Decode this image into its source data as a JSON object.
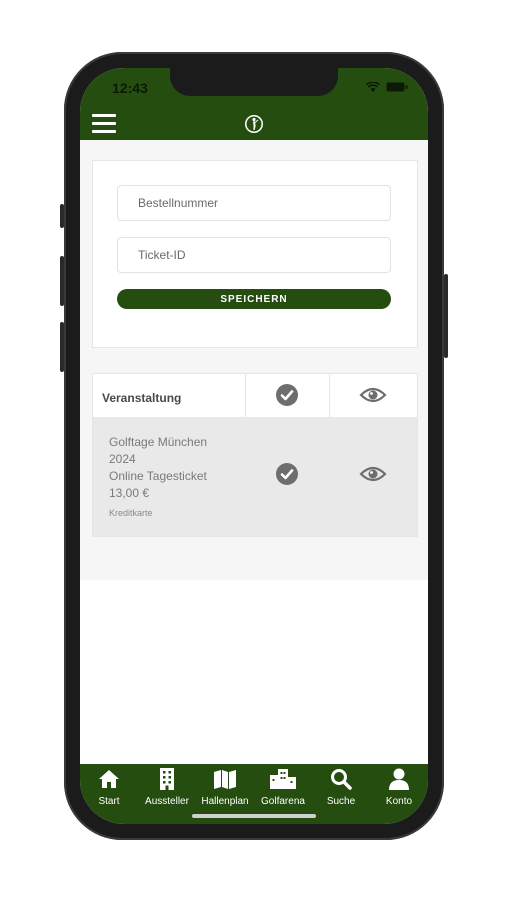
{
  "status_bar": {
    "time": "12:43"
  },
  "form": {
    "order_number_placeholder": "Bestellnummer",
    "ticket_id_placeholder": "Ticket-ID",
    "save_label": "SPEICHERN"
  },
  "table": {
    "header_label": "Veranstaltung",
    "rows": [
      {
        "line1": "Golftage München",
        "line2": "2024",
        "line3": "Online Tagesticket",
        "price": "13,00 €",
        "payment": "Kreditkarte"
      }
    ]
  },
  "tabbar": {
    "items": [
      {
        "label": "Start",
        "icon": "home-icon"
      },
      {
        "label": "Aussteller",
        "icon": "building-icon"
      },
      {
        "label": "Hallenplan",
        "icon": "map-icon"
      },
      {
        "label": "Golfarena",
        "icon": "city-icon"
      },
      {
        "label": "Suche",
        "icon": "search-icon"
      },
      {
        "label": "Konto",
        "icon": "user-icon"
      }
    ]
  },
  "colors": {
    "brand": "#254d10",
    "icon_gray": "#6e6e6e"
  }
}
